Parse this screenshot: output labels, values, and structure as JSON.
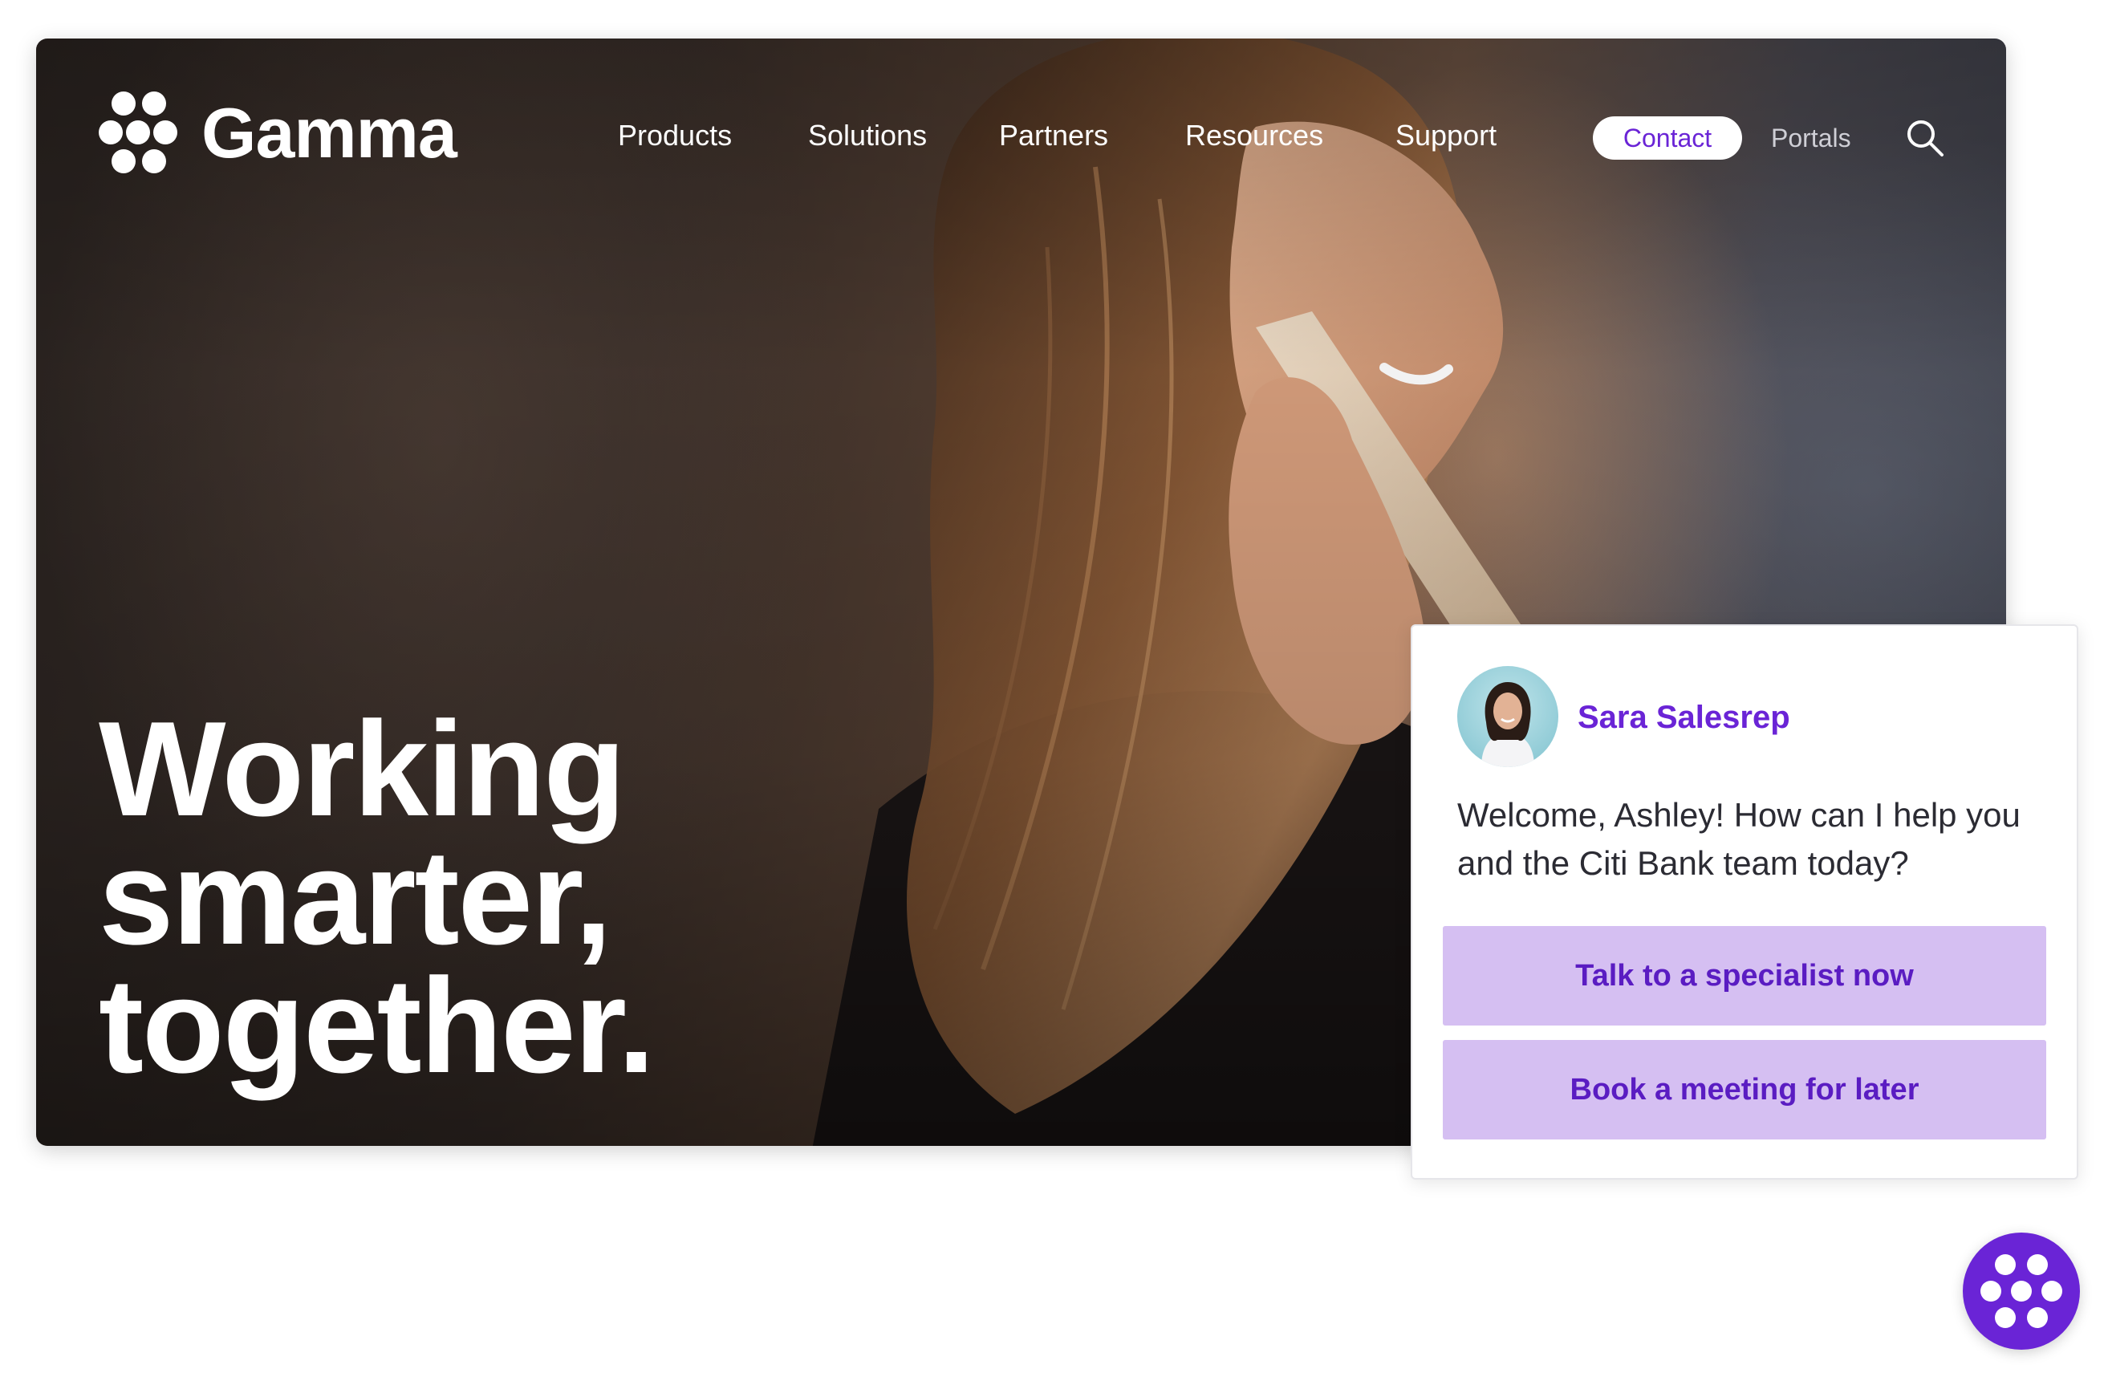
{
  "brand": {
    "name": "Gamma",
    "accent": "#6a24d6",
    "button_fill": "#d5bff2"
  },
  "nav": {
    "items": [
      {
        "label": "Products"
      },
      {
        "label": "Solutions"
      },
      {
        "label": "Partners"
      },
      {
        "label": "Resources"
      },
      {
        "label": "Support"
      }
    ],
    "contact_label": "Contact",
    "portals_label": "Portals",
    "search_icon": "search-icon"
  },
  "hero": {
    "headline_lines": [
      "Working",
      "smarter,",
      "together."
    ]
  },
  "chat": {
    "agent_name": "Sara Salesrep",
    "message": "Welcome, Ashley! How can I help you and the Citi Bank team today?",
    "actions": [
      {
        "label": "Talk to a specialist now"
      },
      {
        "label": "Book a meeting for later"
      }
    ]
  },
  "launcher": {
    "icon": "gamma-logo-icon"
  }
}
